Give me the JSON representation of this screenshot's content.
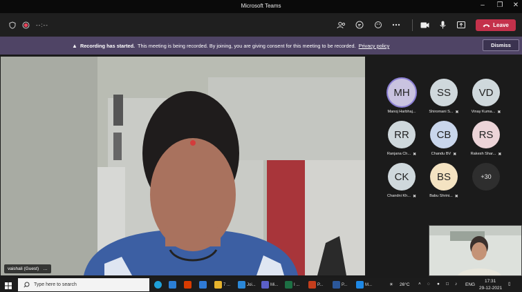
{
  "window": {
    "title": "Microsoft Teams"
  },
  "toolbar": {
    "timer": "--:--",
    "leave_label": "Leave"
  },
  "banner": {
    "strong": "Recording has started.",
    "text": "This meeting is being recorded. By joining, you are giving consent for this meeting to be recorded.",
    "link": "Privacy policy",
    "dismiss_label": "Dismiss"
  },
  "video": {
    "name_tag": "vaishali (Guest)",
    "more": "…"
  },
  "participants": [
    {
      "initials": "MH",
      "name": "Manoj Harbhaj...",
      "color": "#c9c3e0",
      "muted": false
    },
    {
      "initials": "SS",
      "name": "Shiromani S...",
      "color": "#cfd8dc",
      "muted": true
    },
    {
      "initials": "VD",
      "name": "Vinay Kuma...",
      "color": "#cfd8dc",
      "muted": true
    },
    {
      "initials": "RR",
      "name": "Ranjana Ch...",
      "color": "#cfd8dc",
      "muted": true
    },
    {
      "initials": "CB",
      "name": "Chandu BV",
      "color": "#c9d6ec",
      "muted": true
    },
    {
      "initials": "RS",
      "name": "Rakesh Shar...",
      "color": "#ecd4d8",
      "muted": true
    },
    {
      "initials": "CK",
      "name": "Chandni Kh...",
      "color": "#cfd8dc",
      "muted": true
    },
    {
      "initials": "BS",
      "name": "Babu Shrini...",
      "color": "#f4e3c2",
      "muted": true
    }
  ],
  "overflow": {
    "label": "+30"
  },
  "taskbar": {
    "search_placeholder": "Type here to search",
    "apps": [
      {
        "label": "7 ...",
        "color": "#e6b32c"
      },
      {
        "label": "Joi...",
        "color": "#2b88d8"
      },
      {
        "label": "Mi...",
        "color": "#5b5fc7"
      },
      {
        "label": "I ...",
        "color": "#1d7044"
      },
      {
        "label": "P...",
        "color": "#c43e1c"
      },
      {
        "label": "P...",
        "color": "#2b579a"
      },
      {
        "label": "M...",
        "color": "#1e88e5"
      }
    ],
    "weather": "26°C",
    "lang": "ENG",
    "time": "17:31",
    "date": "29-12-2021"
  },
  "colors": {
    "leave": "#c4314b",
    "banner": "#4f4465",
    "accent": "#8b7fd4"
  }
}
